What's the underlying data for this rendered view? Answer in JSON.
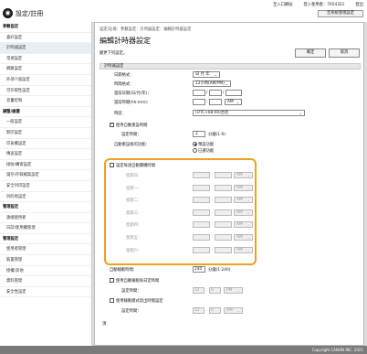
{
  "header": {
    "logo_icon": "remote-ui-logo",
    "app_title": "設定/註冊",
    "links": [
      "至入口網站",
      "登入使用者：",
      "7654321",
      "登出"
    ],
    "system_button": "至系統管理設定"
  },
  "sidebar": {
    "items": [
      {
        "label": "參數設定",
        "head": true
      },
      {
        "label": "喜好設定"
      },
      {
        "label": "計時器設定",
        "active": true
      },
      {
        "label": "常規設定"
      },
      {
        "label": "網路設定"
      },
      {
        "label": "外部介面設定"
      },
      {
        "label": "可存取性設定"
      },
      {
        "label": "音量控制"
      },
      {
        "label": "調整/維護",
        "head": true
      },
      {
        "label": "一般設定"
      },
      {
        "label": "影印設定"
      },
      {
        "label": "印表機設定"
      },
      {
        "label": "傳送設定"
      },
      {
        "label": "接收/轉寄設定"
      },
      {
        "label": "儲存/存取檔案設定"
      },
      {
        "label": "安全列印設定"
      },
      {
        "label": "目的地設定"
      },
      {
        "label": "管理設定",
        "head": true
      },
      {
        "label": "遠端使用者"
      },
      {
        "label": "日誌/使用權管理"
      },
      {
        "label": "管理設定",
        "head": true
      },
      {
        "label": "使用者管理"
      },
      {
        "label": "裝置管理"
      },
      {
        "label": "授權/其他"
      },
      {
        "label": "資料管理"
      },
      {
        "label": "安全性設定"
      }
    ]
  },
  "main": {
    "breadcrumb": "設定/註冊：參數設定：計時器設定：編輯計時器設定",
    "title": "編輯計時器設定",
    "changes_note": "變更下列設定。",
    "ok_label": "確定",
    "cancel_label": "取消",
    "section_label": "計時器設定",
    "date_format_label": "日期格式：",
    "date_format_value": "日 月 年",
    "time_format_label": "時間格式：",
    "time_format_value": "12小時(AM/PM)",
    "current_date_label": "當前日期(日/月/年)：",
    "current_time_label": "當前時間(hh:mm)：",
    "current_time_ampm": "AM",
    "timezone_label": "時區：",
    "timezone_value": "(UTC+08:00)台北",
    "auto_reset_label": "使用自動重設時間",
    "duration_label": "設定時間：",
    "duration_value": "2",
    "duration_unit": "分鐘(1-9)",
    "after_reset_label": "自動重設後的功能：",
    "after_reset_opt1": "預設功能",
    "after_reset_opt2": "已選功能",
    "weekly_label": "設定每週自動關機時間",
    "days": [
      "星期日：",
      "星期一：",
      "星期二：",
      "星期三：",
      "星期四：",
      "星期五：",
      "星期六："
    ],
    "ampm_value": "AM",
    "sleep_label": "自動睡眠時間：",
    "sleep_value": "240",
    "sleep_unit": "分鐘(1-240)",
    "daily_sleep_label": "使用自動睡眠每日定時間",
    "daily_sleep_time_label": "設定時間：",
    "daily_sleep_hh": "12",
    "daily_sleep_mm": "0",
    "daily_sleep_ampm": "PM",
    "wake_label": "使用睡眠模式退出時間設定",
    "wake_time_label": "設定時間：",
    "wake_hh": "12",
    "wake_mm": "0",
    "wake_ampm": "AM",
    "top_link": "頂"
  },
  "footer": {
    "copyright": "Copyright CANON INC. 2021"
  }
}
